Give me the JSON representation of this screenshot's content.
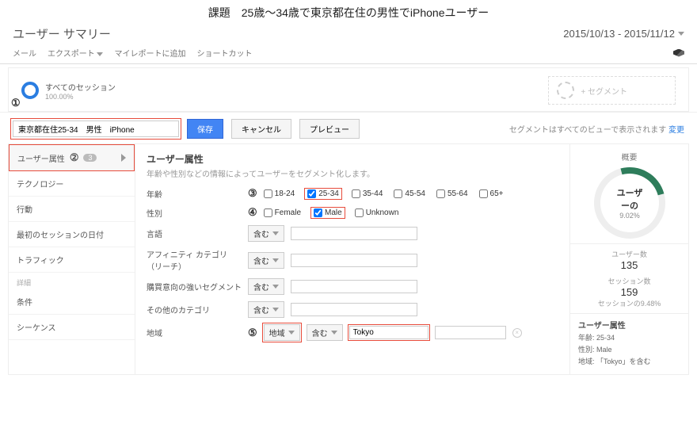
{
  "task_title": "課題　25歳～34歳で東京都在住の男性でiPhoneユーザー",
  "page_title": "ユーザー サマリー",
  "date_range": "2015/10/13 - 2015/11/12",
  "toolbar": {
    "mail": "メール",
    "export": "エクスポート",
    "add_report": "マイレポートに追加",
    "shortcut": "ショートカット"
  },
  "segments": {
    "all": {
      "label": "すべてのセッション",
      "sub": "100.00%"
    },
    "add": {
      "label": "+ セグメント"
    }
  },
  "markers": {
    "m1": "①",
    "m2": "②",
    "m3": "③",
    "m4": "④",
    "m5": "⑤"
  },
  "controls": {
    "segment_name": "東京都在住25-34　男性　iPhone",
    "save": "保存",
    "cancel": "キャンセル",
    "preview": "プレビュー",
    "note": "セグメントはすべてのビューで表示されます",
    "change": "変更"
  },
  "sidebar": {
    "items": [
      {
        "label": "ユーザー属性",
        "badge": "3",
        "active": true
      },
      {
        "label": "テクノロジー"
      },
      {
        "label": "行動"
      },
      {
        "label": "最初のセッションの日付"
      },
      {
        "label": "トラフィック"
      }
    ],
    "detail_head": "詳細",
    "detail_items": [
      {
        "label": "条件"
      },
      {
        "label": "シーケンス"
      }
    ]
  },
  "panel": {
    "title": "ユーザー属性",
    "subtitle": "年齢や性別などの情報によってユーザーをセグメント化します。",
    "rows": {
      "age": {
        "label": "年齢",
        "opts": [
          "18-24",
          "25-34",
          "35-44",
          "45-54",
          "55-64",
          "65+"
        ],
        "checked": "25-34"
      },
      "gender": {
        "label": "性別",
        "opts": [
          "Female",
          "Male",
          "Unknown"
        ],
        "checked": "Male"
      },
      "language": {
        "label": "言語",
        "dd": "含む"
      },
      "affinity": {
        "label": "アフィニティ カテゴリ（リーチ）",
        "dd": "含む"
      },
      "inmarket": {
        "label": "購買意向の強いセグメント",
        "dd": "含む"
      },
      "other": {
        "label": "その他のカテゴリ",
        "dd": "含む"
      },
      "region": {
        "label": "地域",
        "dd1": "地域",
        "dd2": "含む",
        "value": "Tokyo"
      }
    }
  },
  "summary": {
    "head": "概要",
    "gauge_label": "ユーザーの",
    "gauge_pct": "9.02%",
    "users": {
      "lbl": "ユーザー数",
      "num": "135"
    },
    "sessions": {
      "lbl": "セッション数",
      "num": "159",
      "sub": "セッションの9.48%"
    },
    "attr_title": "ユーザー属性",
    "kv": [
      "年齢: 25-34",
      "性別: Male",
      "地域: 「Tokyo」を含む"
    ]
  }
}
